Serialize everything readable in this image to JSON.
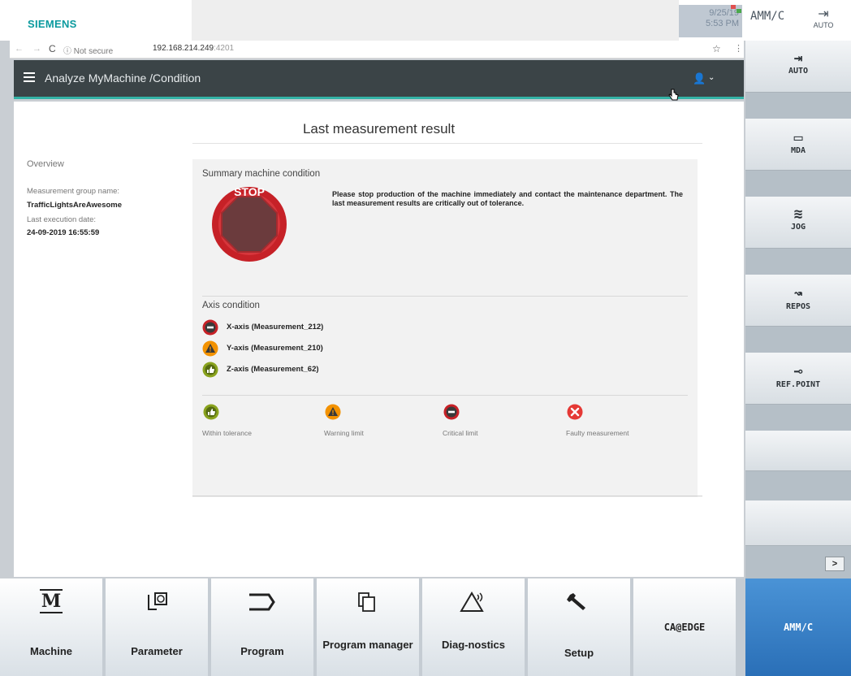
{
  "top": {
    "brand": "SIEMENS",
    "date": "9/25/19",
    "time": "5:53 PM",
    "mode": "AMM/C",
    "auto_label": "AUTO"
  },
  "browser": {
    "nav": "← →",
    "reload": "C",
    "security": "ⓘ Not secure",
    "url_host": "192.168.214.249",
    "url_port": ":4201"
  },
  "header": {
    "title": "Analyze MyMachine /Condition"
  },
  "main": {
    "title": "Last measurement result",
    "overview": {
      "heading": "Overview",
      "group_label": "Measurement group name:",
      "group_value": "TrafficLightsAreAwesome",
      "date_label": "Last execution date:",
      "date_value": "24-09-2019 16:55:59"
    },
    "summary": {
      "heading": "Summary machine condition",
      "stop_label": "STOP",
      "message": "Please stop production of the machine immediately and contact the maintenance department. The last measurement results are critically out of tolerance."
    },
    "axis": {
      "heading": "Axis condition",
      "rows": [
        {
          "label": "X-axis (Measurement_212)",
          "status": "critical"
        },
        {
          "label": "Y-axis (Measurement_210)",
          "status": "warning"
        },
        {
          "label": "Z-axis (Measurement_62)",
          "status": "ok"
        }
      ]
    },
    "legend": [
      {
        "label": "Within tolerance",
        "status": "ok"
      },
      {
        "label": "Warning limit",
        "status": "warning"
      },
      {
        "label": "Critical limit",
        "status": "critical"
      },
      {
        "label": "Faulty measurement",
        "status": "faulty"
      }
    ]
  },
  "right_softkeys": [
    {
      "label": "AUTO",
      "icon": "auto-arrow-icon"
    },
    {
      "label": "MDA",
      "icon": "mda-screen-icon"
    },
    {
      "label": "JOG",
      "icon": "jog-wave-icon"
    },
    {
      "label": "REPOS",
      "icon": "repos-arrow-icon"
    },
    {
      "label": "REF.POINT",
      "icon": "ref-point-icon"
    }
  ],
  "bottom_softkeys": [
    {
      "label": "Machine",
      "icon": "machine-m-icon"
    },
    {
      "label": "Parameter",
      "icon": "parameter-icon"
    },
    {
      "label": "Program",
      "icon": "program-icon"
    },
    {
      "label": "Program manager",
      "icon": "program-manager-icon"
    },
    {
      "label": "Diag-nostics",
      "icon": "diagnostics-icon"
    },
    {
      "label": "Setup",
      "icon": "wrench-icon"
    },
    {
      "label": "CA@EDGE",
      "icon": ""
    },
    {
      "label": "AMM/C",
      "icon": ""
    }
  ],
  "colors": {
    "accent_teal": "#33b3a6",
    "critical": "#c62127",
    "warning": "#f39200",
    "ok": "#8aa31e",
    "faulty": "#e53935",
    "active_softkey": "#2a6fb7"
  }
}
